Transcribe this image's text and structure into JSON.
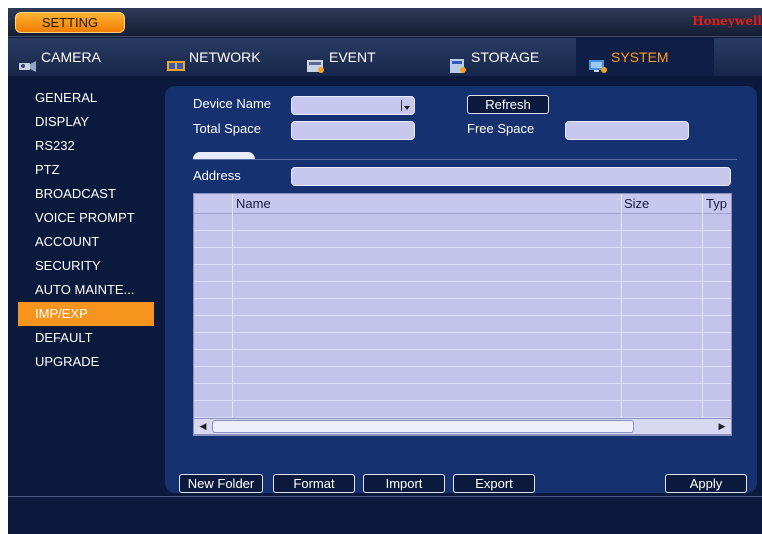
{
  "titlebar": {
    "setting_label": "SETTING",
    "brand": "Honeywell"
  },
  "tabs": [
    {
      "label": "CAMERA",
      "icon": "camera-icon"
    },
    {
      "label": "NETWORK",
      "icon": "network-icon"
    },
    {
      "label": "EVENT",
      "icon": "event-icon"
    },
    {
      "label": "STORAGE",
      "icon": "storage-icon"
    },
    {
      "label": "SYSTEM",
      "icon": "system-icon",
      "active": true
    }
  ],
  "sidebar": {
    "items": [
      {
        "label": "GENERAL"
      },
      {
        "label": "DISPLAY"
      },
      {
        "label": "RS232"
      },
      {
        "label": "PTZ"
      },
      {
        "label": "BROADCAST"
      },
      {
        "label": "VOICE PROMPT"
      },
      {
        "label": "ACCOUNT"
      },
      {
        "label": "SECURITY"
      },
      {
        "label": "AUTO MAINTE..."
      },
      {
        "label": "IMP/EXP",
        "active": true
      },
      {
        "label": "DEFAULT"
      },
      {
        "label": "UPGRADE"
      }
    ]
  },
  "form": {
    "device_name_label": "Device Name",
    "device_name_value": "",
    "refresh_label": "Refresh",
    "total_space_label": "Total Space",
    "total_space_value": "",
    "free_space_label": "Free Space",
    "free_space_value": "",
    "address_label": "Address",
    "address_value": ""
  },
  "table": {
    "columns": [
      "Name",
      "Size",
      "Typ"
    ],
    "rows": []
  },
  "buttons": {
    "new_folder": "New Folder",
    "format": "Format",
    "import": "Import",
    "export": "Export",
    "apply": "Apply"
  },
  "colors": {
    "accent": "#f7941d",
    "brand": "#e31b1b",
    "panel": "#15316f",
    "background": "#0b1a3c"
  }
}
